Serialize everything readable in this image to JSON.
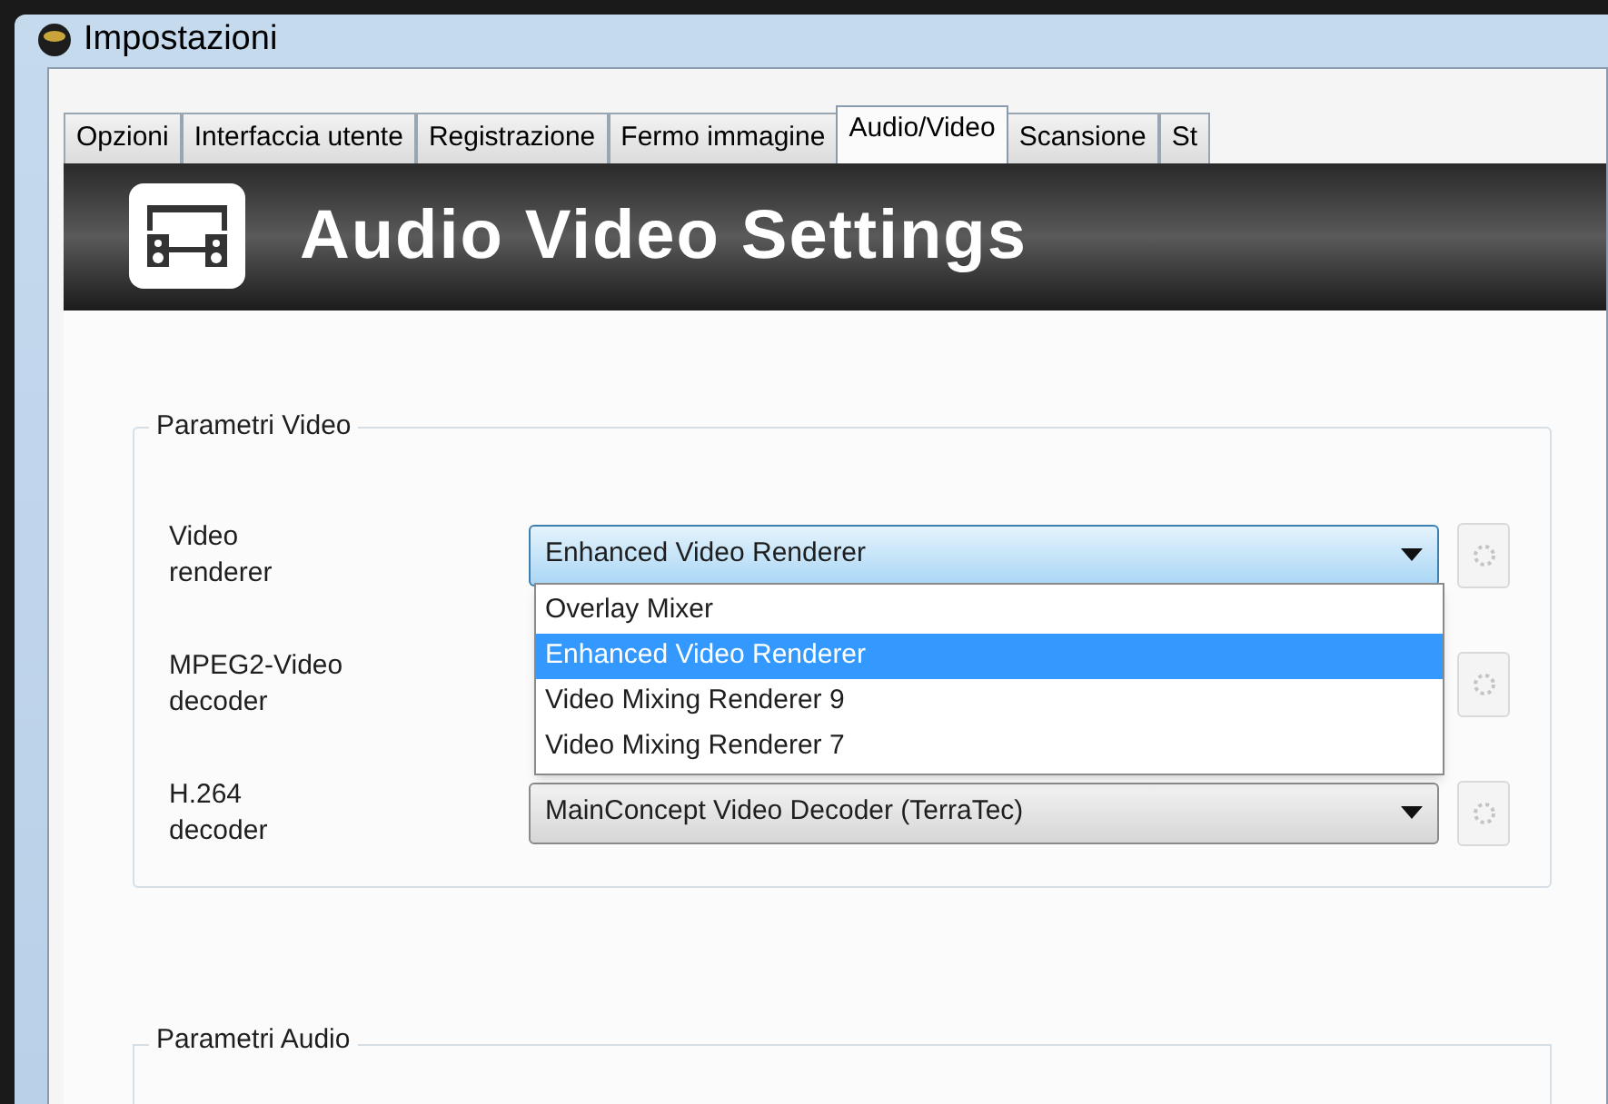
{
  "window": {
    "title": "Impostazioni"
  },
  "tabs": [
    {
      "label": "Opzioni",
      "selected": false
    },
    {
      "label": "Interfaccia utente",
      "selected": false
    },
    {
      "label": "Registrazione",
      "selected": false
    },
    {
      "label": "Fermo immagine",
      "selected": false
    },
    {
      "label": "Audio/Video",
      "selected": true
    },
    {
      "label": "Scansione",
      "selected": false
    },
    {
      "label": "St",
      "selected": false
    }
  ],
  "banner": {
    "title": "Audio Video Settings"
  },
  "video_params": {
    "legend": "Parametri Video",
    "rows": [
      {
        "label": "Video renderer",
        "value": "Enhanced Video Renderer",
        "expanded": true,
        "button_disabled": true
      },
      {
        "label": "MPEG2-Video decoder",
        "button_disabled": true
      },
      {
        "label": "H.264 decoder",
        "value": "MainConcept Video Decoder (TerraTec)",
        "expanded": false,
        "button_disabled": true
      }
    ]
  },
  "dropdown": {
    "options": [
      {
        "label": "Overlay Mixer",
        "selected": false
      },
      {
        "label": "Enhanced Video Renderer",
        "selected": true
      },
      {
        "label": "Video Mixing Renderer 9",
        "selected": false
      },
      {
        "label": "Video Mixing Renderer 7",
        "selected": false
      }
    ]
  },
  "audio_params": {
    "legend": "Parametri Audio"
  }
}
